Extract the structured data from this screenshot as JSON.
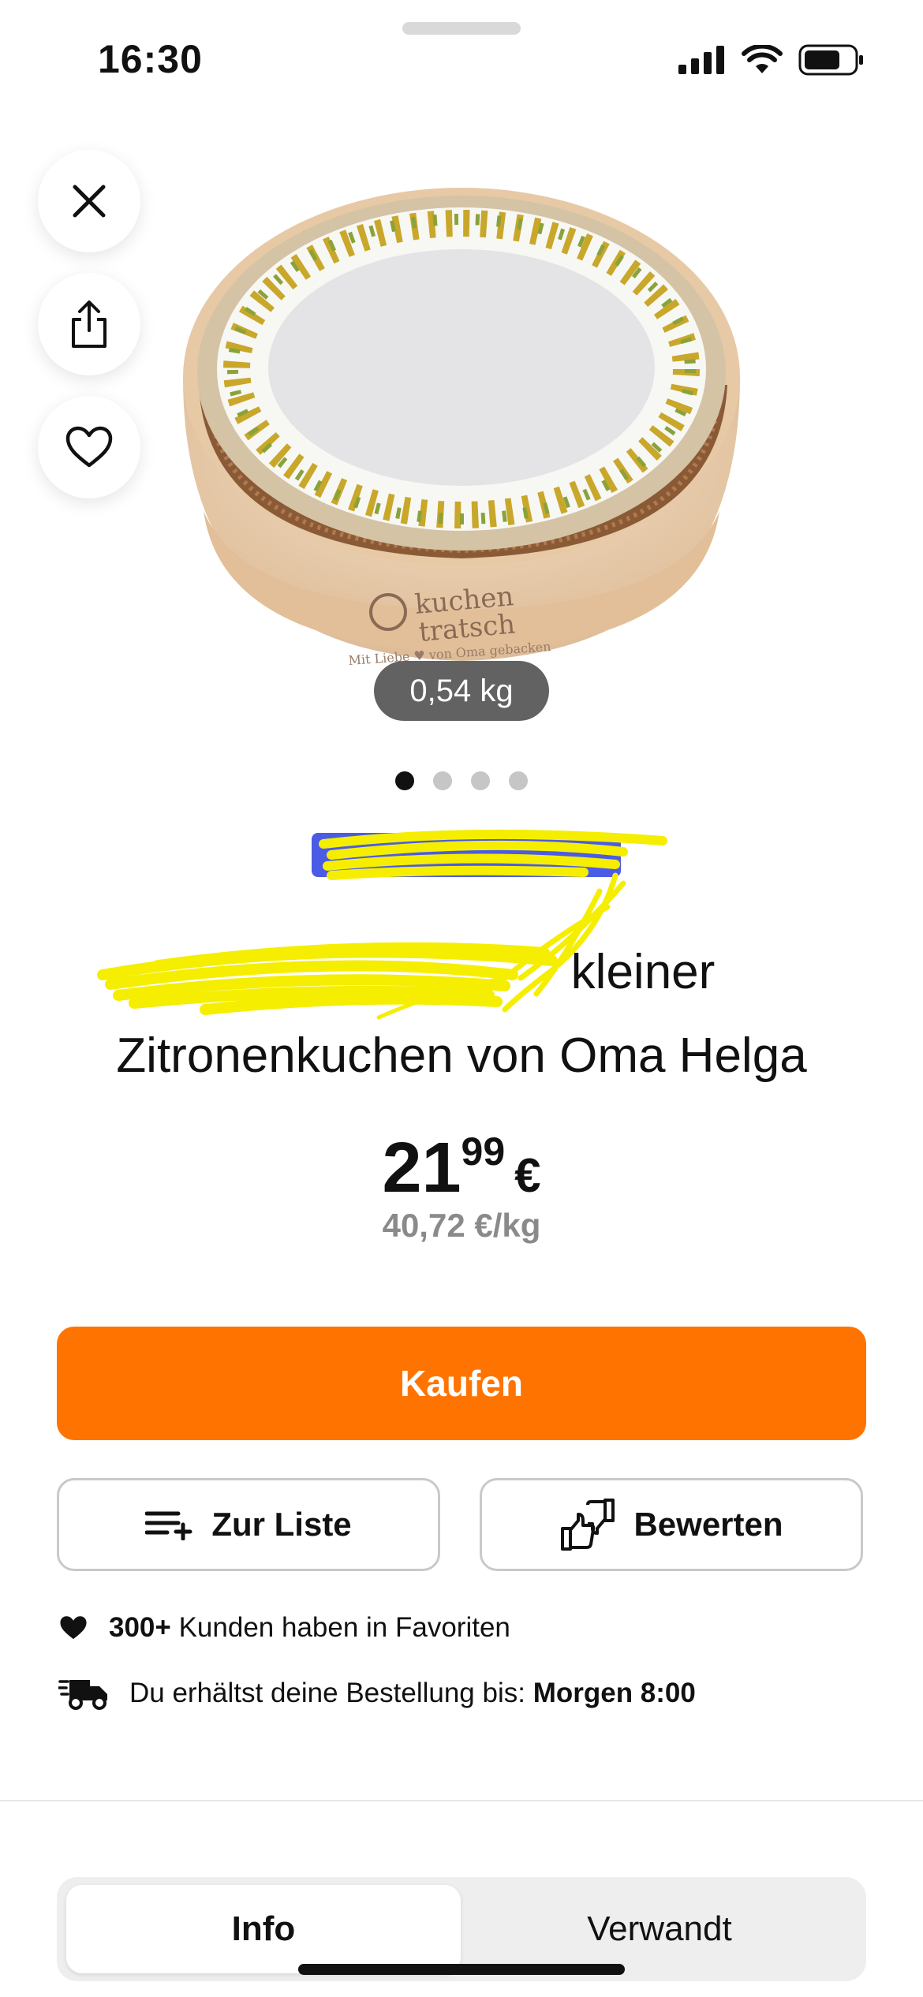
{
  "status_bar": {
    "time": "16:30"
  },
  "actions": {
    "close_icon": "close-icon",
    "share_icon": "share-icon",
    "favorite_icon": "heart-icon"
  },
  "product": {
    "image_text": {
      "brand_line1": "kuchen",
      "brand_line2": "tratsch",
      "slogan": "Mit Liebe ♥ von Oma gebacken"
    },
    "weight": "0,54 kg",
    "pager": {
      "total": 4,
      "active_index": 0
    },
    "title_line1": "kleiner",
    "title_line2": "Zitronenkuchen von Oma Helga",
    "price_whole": "21",
    "price_cents": "99",
    "currency": "€",
    "unit_price": "40,72 €/kg"
  },
  "buttons": {
    "buy": "Kaufen",
    "add_to_list": "Zur Liste",
    "rate": "Bewerten"
  },
  "info": {
    "favorites_count": "300+",
    "favorites_text": "Kunden haben in Favoriten",
    "delivery_text": "Du erhältst deine Bestellung bis:",
    "delivery_time": "Morgen 8:00"
  },
  "tabs": [
    {
      "label": "Info",
      "active": true
    },
    {
      "label": "Verwandt",
      "active": false
    }
  ],
  "colors": {
    "accent": "#ff7400",
    "scribble": "#f5ee00",
    "redaction_blue": "#4b5be6"
  }
}
